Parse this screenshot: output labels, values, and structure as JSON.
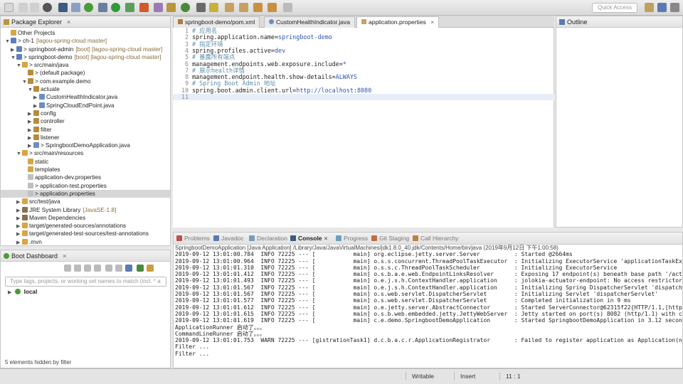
{
  "toolbar": {
    "quick_access": "Quick Access"
  },
  "package_explorer": {
    "title": "Package Explorer",
    "rows": [
      {
        "indent": 0,
        "tw": "",
        "icon": "folder",
        "label": "Other Projects",
        "extra": ""
      },
      {
        "indent": 0,
        "tw": "▼",
        "icon": "proj",
        "label": "> ch-1",
        "extra": "[lagou-spring-cloud master]"
      },
      {
        "indent": 1,
        "tw": "▶",
        "icon": "proj",
        "label": "> springboot-admin",
        "extra": "[boot] [lagou-spring-cloud master]"
      },
      {
        "indent": 1,
        "tw": "▼",
        "icon": "proj",
        "label": "> springboot-demo",
        "extra": "[boot] [lagou-spring-cloud master]"
      },
      {
        "indent": 2,
        "tw": "▼",
        "icon": "folder",
        "label": "> src/main/java",
        "extra": ""
      },
      {
        "indent": 3,
        "tw": "",
        "icon": "pkg",
        "label": "> (default package)",
        "extra": ""
      },
      {
        "indent": 3,
        "tw": "▼",
        "icon": "pkg",
        "label": "> com.example.demo",
        "extra": ""
      },
      {
        "indent": 4,
        "tw": "▼",
        "icon": "pkg",
        "label": "actuate",
        "extra": ""
      },
      {
        "indent": 5,
        "tw": "▶",
        "icon": "java",
        "label": "CustomHealthIndicator.java",
        "extra": ""
      },
      {
        "indent": 5,
        "tw": "▶",
        "icon": "java",
        "label": "SpringCloudEndPoint.java",
        "extra": ""
      },
      {
        "indent": 4,
        "tw": "▶",
        "icon": "pkg",
        "label": "config",
        "extra": ""
      },
      {
        "indent": 4,
        "tw": "▶",
        "icon": "pkg",
        "label": "controller",
        "extra": ""
      },
      {
        "indent": 4,
        "tw": "▶",
        "icon": "pkg",
        "label": "filter",
        "extra": ""
      },
      {
        "indent": 4,
        "tw": "▶",
        "icon": "pkg",
        "label": "listener",
        "extra": ""
      },
      {
        "indent": 4,
        "tw": "▶",
        "icon": "java",
        "label": "> SpringbootDemoApplication.java",
        "extra": ""
      },
      {
        "indent": 2,
        "tw": "▼",
        "icon": "folder",
        "label": "> src/main/resources",
        "extra": ""
      },
      {
        "indent": 3,
        "tw": "",
        "icon": "folder",
        "label": "static",
        "extra": ""
      },
      {
        "indent": 3,
        "tw": "",
        "icon": "folder",
        "label": "templates",
        "extra": ""
      },
      {
        "indent": 3,
        "tw": "",
        "icon": "file",
        "label": "application-dev.properties",
        "extra": ""
      },
      {
        "indent": 3,
        "tw": "",
        "icon": "file",
        "label": "> application-test.properties",
        "extra": ""
      },
      {
        "indent": 3,
        "tw": "",
        "icon": "file",
        "label": "> application.properties",
        "extra": "",
        "selected": true
      },
      {
        "indent": 2,
        "tw": "▶",
        "icon": "folder",
        "label": "src/test/java",
        "extra": ""
      },
      {
        "indent": 2,
        "tw": "▶",
        "icon": "lib",
        "label": "JRE System Library",
        "extra": "[JavaSE-1.8]"
      },
      {
        "indent": 2,
        "tw": "▶",
        "icon": "lib",
        "label": "Maven Dependencies",
        "extra": ""
      },
      {
        "indent": 2,
        "tw": "▶",
        "icon": "folder",
        "label": "target/generated-sources/annotations",
        "extra": ""
      },
      {
        "indent": 2,
        "tw": "▶",
        "icon": "folder",
        "label": "target/generated-test-sources/test-annotations",
        "extra": ""
      },
      {
        "indent": 2,
        "tw": "▶",
        "icon": "folder",
        "label": ".mvn",
        "extra": ""
      }
    ]
  },
  "boot_dashboard": {
    "title": "Boot Dashboard",
    "search_placeholder": "Type tags, projects, or working set names to match (incl. * a",
    "local_label": "local",
    "footer": "5 elements hidden by filter"
  },
  "editor": {
    "tabs": [
      "springboot-demo/pom.xml",
      "CustomHealthIndicator.java",
      "application.properties"
    ],
    "active_tab": 2,
    "lines": [
      {
        "n": "1",
        "kind": "comment",
        "text": "# 应用名"
      },
      {
        "n": "2",
        "kind": "kv",
        "key": "spring.application.name=",
        "value": "springboot-demo"
      },
      {
        "n": "3",
        "kind": "comment",
        "text": "# 指定环境"
      },
      {
        "n": "4",
        "kind": "kv",
        "key": "spring.profiles.active=",
        "value": "dev"
      },
      {
        "n": "5",
        "kind": "comment",
        "text": "# 暴露所有端点"
      },
      {
        "n": "6",
        "kind": "kv",
        "key": "management.endpoints.web.exposure.include=",
        "value": "*"
      },
      {
        "n": "7",
        "kind": "comment",
        "text": "# 展示health详情"
      },
      {
        "n": "8",
        "kind": "kv",
        "key": "management.endpoint.health.show-details=",
        "value": "ALWAYS"
      },
      {
        "n": "9",
        "kind": "comment",
        "text": "# Spring Boot Admin 地址"
      },
      {
        "n": "10",
        "kind": "kv",
        "key": "spring.boot.admin.client.url=",
        "value": "http://localhost:8080"
      },
      {
        "n": "11",
        "kind": "empty",
        "text": ""
      }
    ]
  },
  "outline": {
    "title": "Outline"
  },
  "console": {
    "tabs": [
      "Problems",
      "Javadoc",
      "Declaration",
      "Console",
      "Progress",
      "Git Staging",
      "Call Hierarchy"
    ],
    "active_tab": 3,
    "header": "SpringbootDemoApplication [Java Application] /Library/Java/JavaVirtualMachines/jdk1.8.0_40.jdk/Contents/Home/bin/java (2019年9月12日 下午1:00:58)",
    "lines": [
      "2019-09-12 13:01:00.784  INFO 72225 --- [           main] org.eclipse.jetty.server.Server          : Started @2664ms",
      "2019-09-12 13:01:00.964  INFO 72225 --- [           main] o.s.s.concurrent.ThreadPoolTaskExecutor  : Initializing ExecutorService 'applicationTaskEx",
      "2019-09-12 13:01:01.310  INFO 72225 --- [           main] o.s.s.c.ThreadPoolTaskScheduler          : Initializing ExecutorService",
      "2019-09-12 13:01:01.412  INFO 72225 --- [           main] o.s.b.a.e.web.EndpointLinksResolver      : Exposing 17 endpoint(s) beneath base path '/act",
      "2019-09-12 13:01:01.493  INFO 72225 --- [           main] o.e.j.s.h.ContextHandler.application     : jolokia-actuator-endpoint: No access restrictor",
      "2019-09-12 13:01:01.567  INFO 72225 --- [           main] o.e.j.s.h.ContextHandler.application     : Initializing Spring DispatcherServlet 'dispatch",
      "2019-09-12 13:01:01.567  INFO 72225 --- [           main] o.s.web.servlet.DispatcherServlet        : Initializing Servlet 'dispatcherServlet'",
      "2019-09-12 13:01:01.577  INFO 72225 --- [           main] o.s.web.servlet.DispatcherServlet        : Completed initialization in 9 ms",
      "2019-09-12 13:01:01.612  INFO 72225 --- [           main] o.e.jetty.server.AbstractConnector       : Started ServerConnector@62315f22{HTTP/1.1,[http",
      "2019-09-12 13:01:01.615  INFO 72225 --- [           main] o.s.b.web.embedded.jetty.JettyWebServer  : Jetty started on port(s) 8082 (http/1.1) with c",
      "2019-09-12 13:01:01.619  INFO 72225 --- [           main] c.e.demo.SpringbootDemoApplication       : Started SpringbootDemoApplication in 3.12 secon",
      "ApplicationRunner 启动了。。。",
      "CommandLineRunner 启动了。。。",
      "2019-09-12 13:01:01.753  WARN 72225 --- [gistrationTask1] d.c.b.a.c.r.ApplicationRegistrator       : Failed to register application as Application(n",
      "Filter ...",
      "Filter ..."
    ]
  },
  "statusbar": {
    "writable": "Writable",
    "insert": "Insert",
    "position": "11 : 1"
  },
  "colors": {
    "comment": "#5f8fa8",
    "value": "#2a55b5",
    "selection": "#d6d6d6"
  }
}
